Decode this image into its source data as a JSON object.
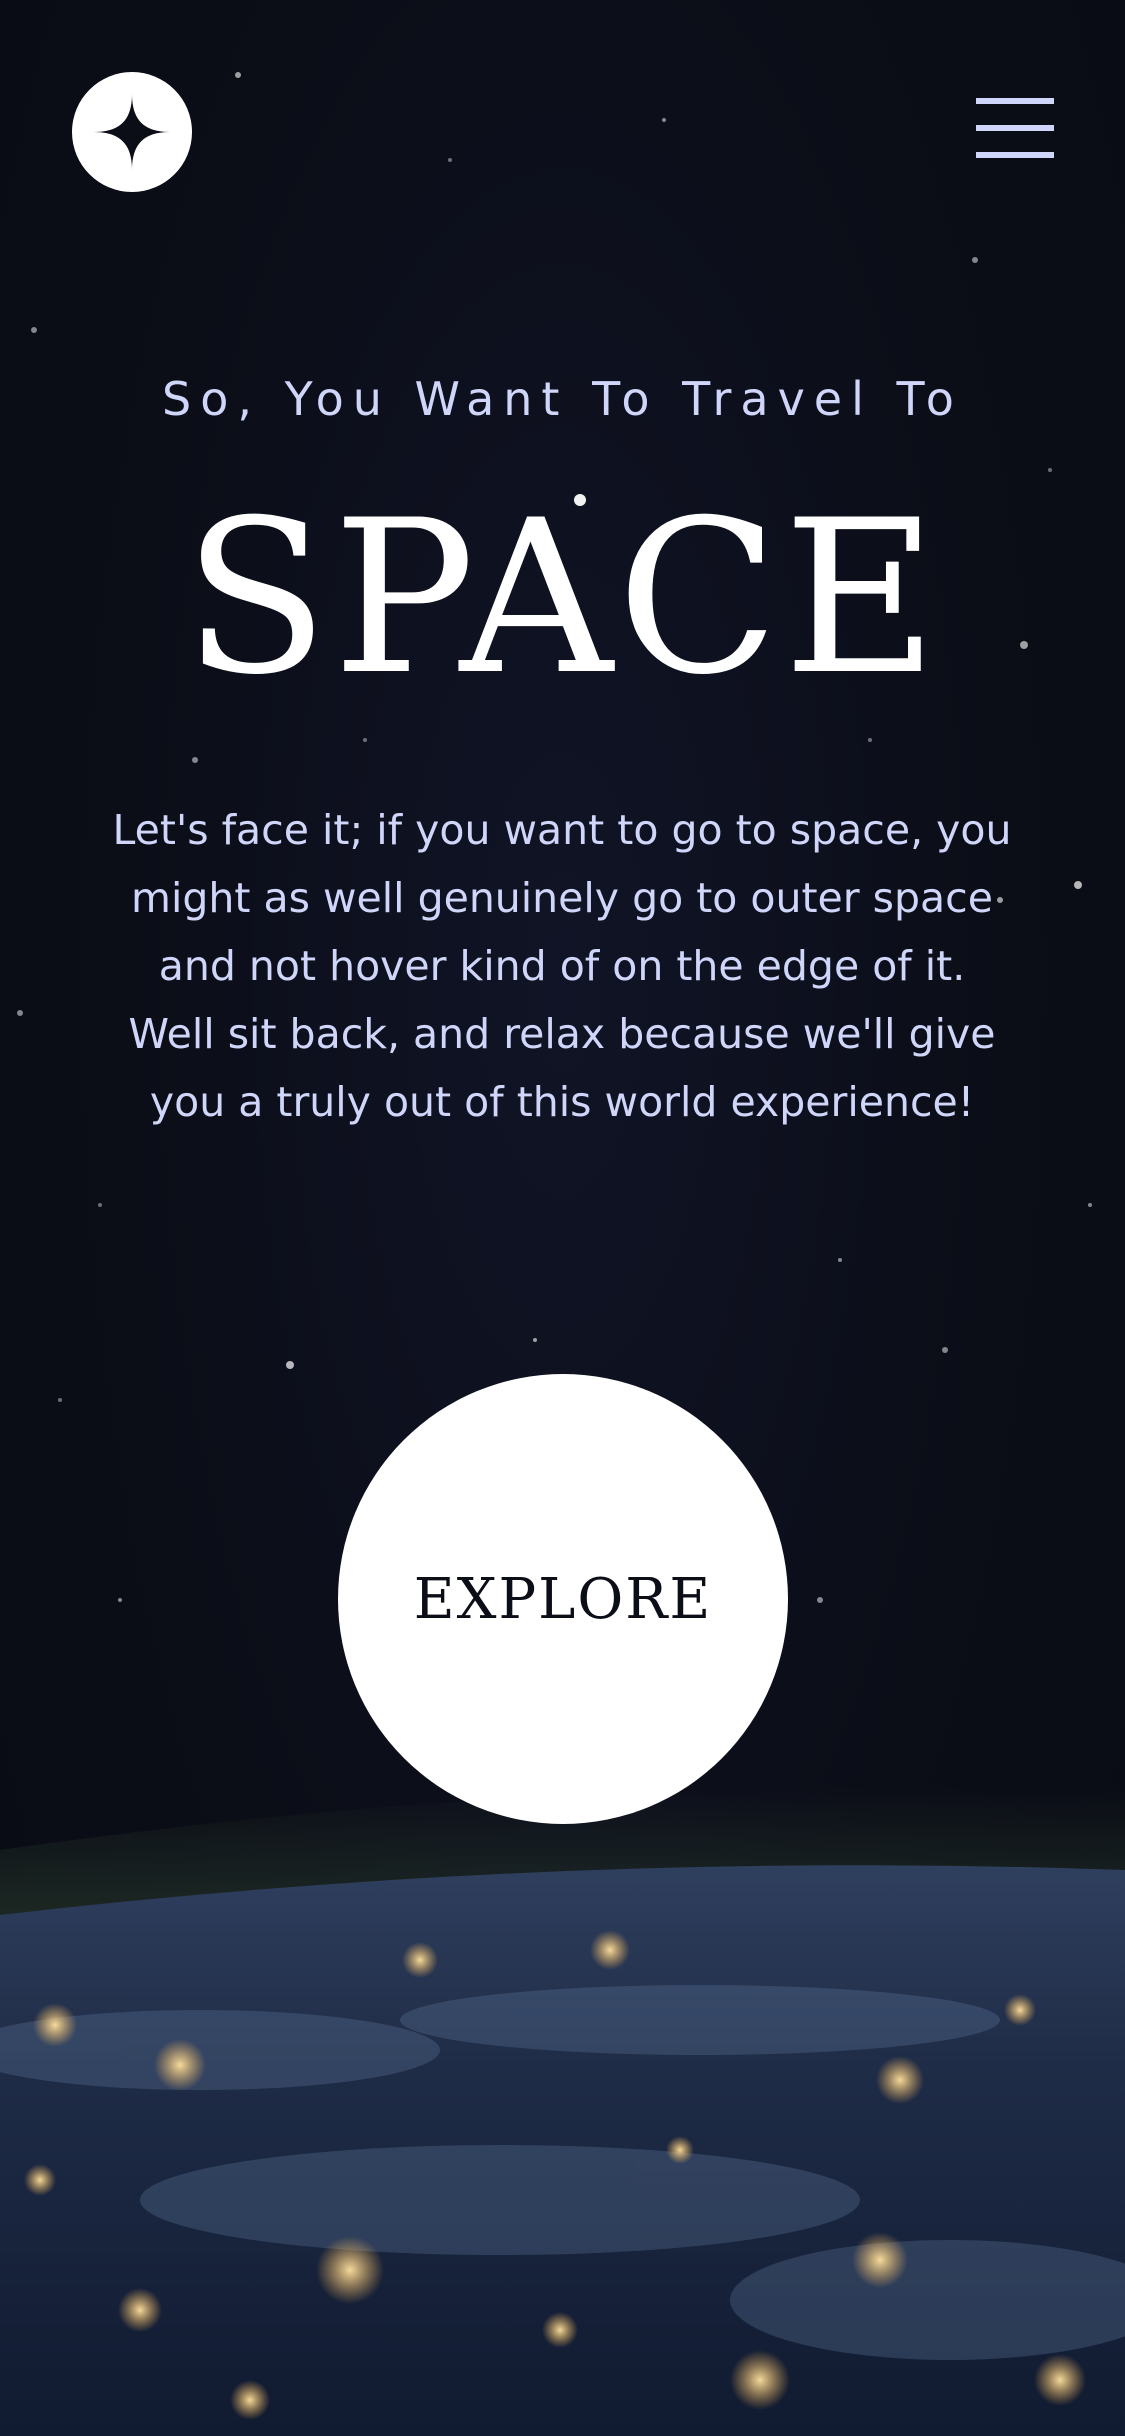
{
  "colors": {
    "background": "#0b0d17",
    "accent_light": "#d0d6f9",
    "white": "#ffffff"
  },
  "header": {
    "logo_icon": "four-point-star-icon",
    "menu_icon": "hamburger-menu-icon"
  },
  "hero": {
    "kicker": "So, You Want To Travel To",
    "title": "SPACE",
    "description": "Let's face it; if you want to go to space, you might as well genuinely go to outer space and not hover kind of on the edge of it. Well sit back, and relax because we'll give you a truly out of this world experience!",
    "explore_label": "EXPLORE"
  }
}
